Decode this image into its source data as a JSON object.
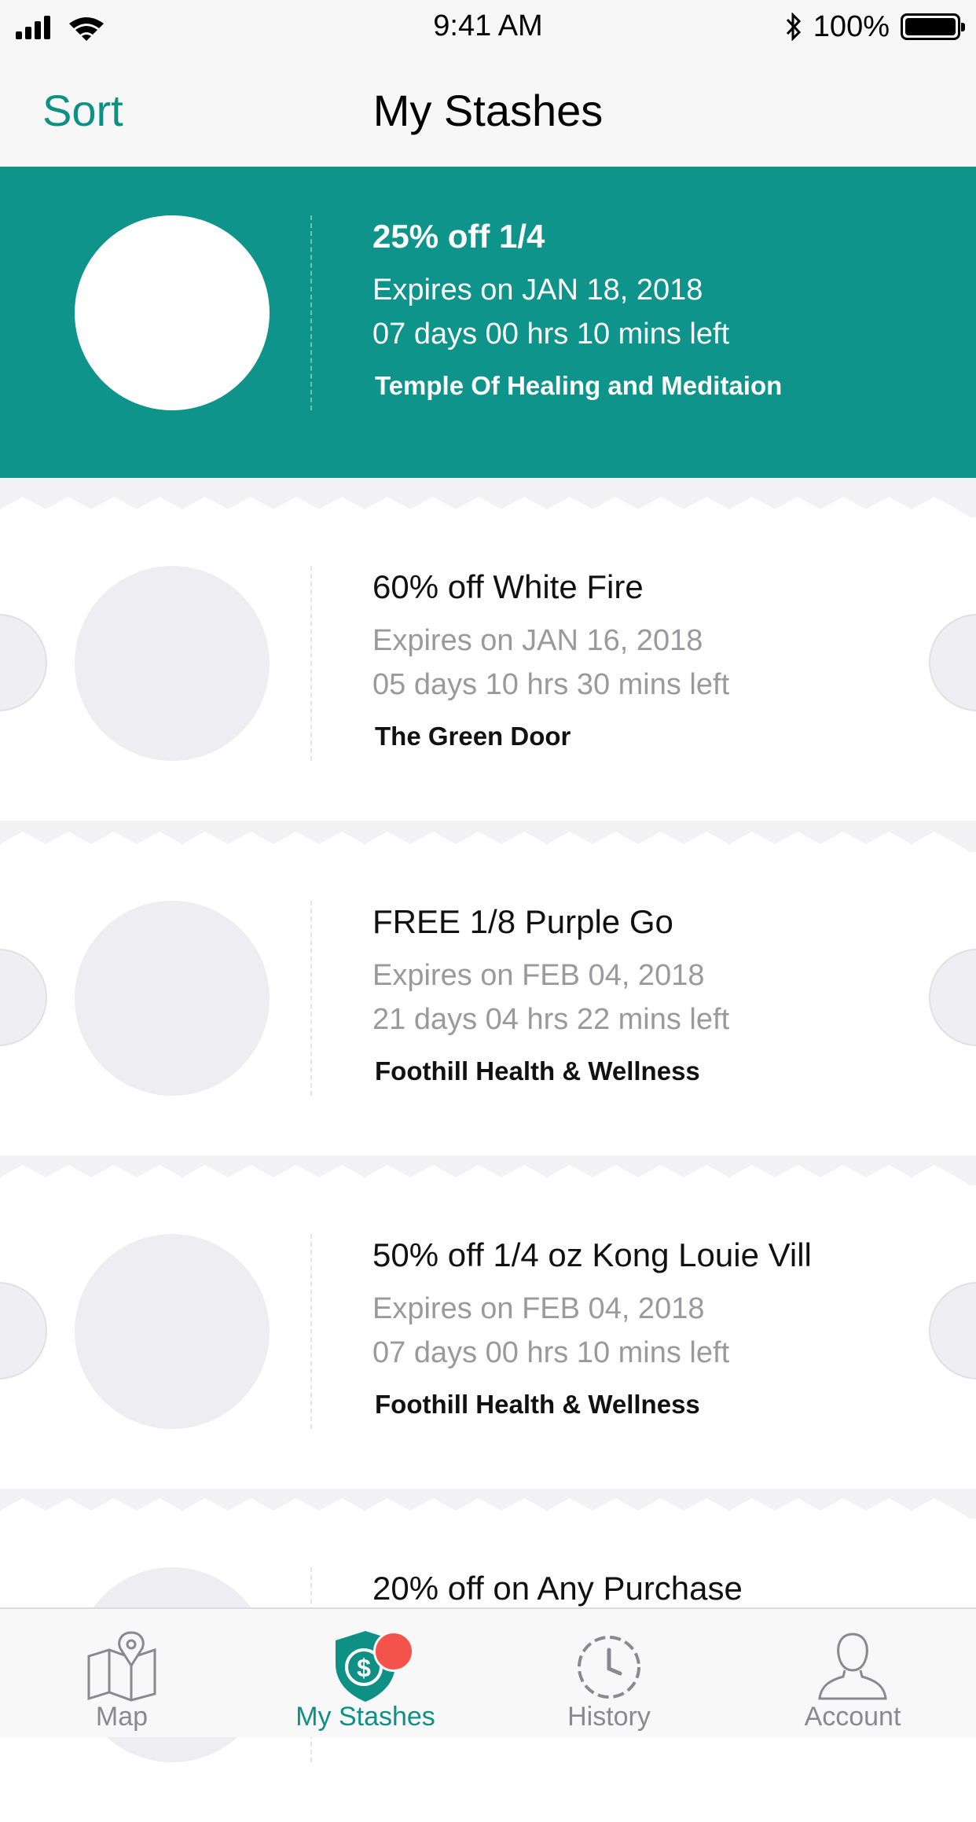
{
  "status_bar": {
    "time": "9:41 AM",
    "battery": "100%"
  },
  "nav": {
    "sort_label": "Sort",
    "title": "My Stashes"
  },
  "coupons": [
    {
      "title": "25% off 1/4",
      "expires": "Expires on JAN 18, 2018",
      "time_left": "07 days 00 hrs 10 mins left",
      "store": "Temple Of Healing and Meditaion",
      "active": true
    },
    {
      "title": "60% off White Fire",
      "expires": "Expires on JAN 16, 2018",
      "time_left": "05 days 10 hrs 30 mins left",
      "store": "The Green Door"
    },
    {
      "title": "FREE 1/8 Purple Go",
      "expires": "Expires on FEB 04, 2018",
      "time_left": "21 days 04 hrs 22 mins left",
      "store": "Foothill Health & Wellness"
    },
    {
      "title": "50% off 1/4 oz Kong Louie Vill",
      "expires": "Expires on FEB 04, 2018",
      "time_left": "07 days 00 hrs 10 mins left",
      "store": "Foothill Health & Wellness"
    },
    {
      "title": "20% off on Any Purchase",
      "expires": "",
      "time_left": "",
      "store": ""
    }
  ],
  "tabs": [
    {
      "label": "Map",
      "icon": "map-icon"
    },
    {
      "label": "My Stashes",
      "icon": "stash-shield-icon",
      "active": true
    },
    {
      "label": "History",
      "icon": "history-clock-icon"
    },
    {
      "label": "Account",
      "icon": "account-person-icon"
    }
  ],
  "colors": {
    "accent": "#0e948b",
    "badge": "#f4534c",
    "inactive": "#8a8a8e"
  }
}
